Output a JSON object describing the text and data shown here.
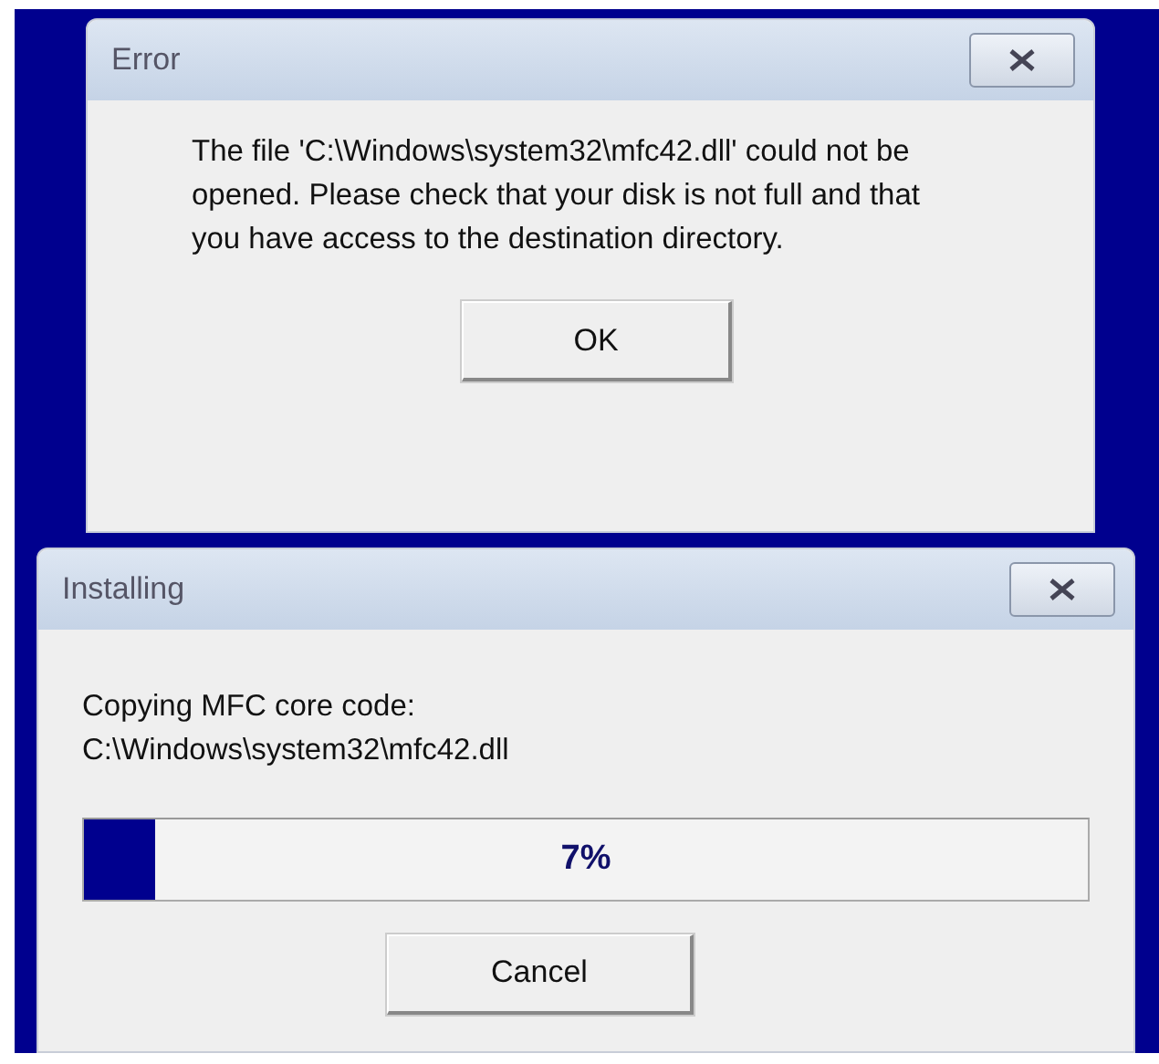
{
  "error_dialog": {
    "title": "Error",
    "message": "The file 'C:\\Windows\\system32\\mfc42.dll' could not be opened. Please check that your disk is not full and that you have access to the destination directory.",
    "buttons": [
      "OK"
    ]
  },
  "install_dialog": {
    "title": "Installing",
    "status": "Copying MFC core code:",
    "file": "C:\\Windows\\system32\\mfc42.dll",
    "progress": {
      "level": 0.07,
      "reading": "7%"
    },
    "buttons": [
      "Cancel"
    ]
  }
}
